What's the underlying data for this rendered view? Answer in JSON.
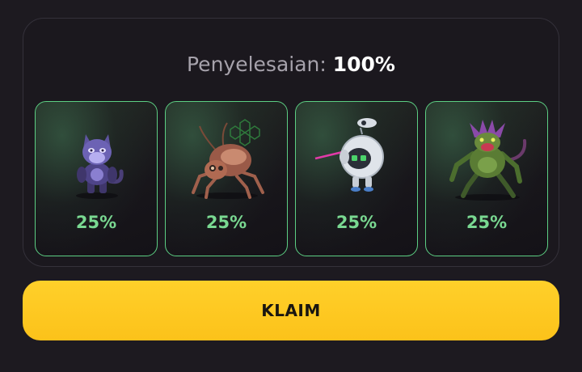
{
  "progress": {
    "label": "Penyelesaian:",
    "value": "100%"
  },
  "cards": [
    {
      "creature": "purple-panther-creature-image",
      "chance": "25%"
    },
    {
      "creature": "mechanical-spider-creature-image",
      "chance": "25%"
    },
    {
      "creature": "robot-drone-creature-image",
      "chance": "25%"
    },
    {
      "creature": "green-alien-beast-creature-image",
      "chance": "25%"
    }
  ],
  "actions": {
    "claim_label": "KLAIM"
  },
  "colors": {
    "background": "#1d1a20",
    "card_border": "#5ccf83",
    "chance_text": "#79d891",
    "button": "#fdc620"
  }
}
